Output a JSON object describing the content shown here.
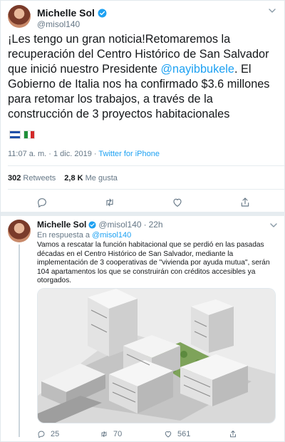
{
  "main_tweet": {
    "author_name": "Michelle Sol",
    "author_handle": "@misol140",
    "text_before_mention": "¡Les tengo un gran noticia!Retomaremos la recuperación del Centro Histórico de San Salvador que inició nuestro Presidente ",
    "mention": "@nayibbukele",
    "text_after_mention": ". El Gobierno de Italia nos ha confirmado $3.6 millones para retomar los trabajos, a través de la construcción de 3 proyectos habitacionales",
    "timestamp": "11:07 a. m. · 1 dic. 2019 · ",
    "source": "Twitter for iPhone",
    "retweets_count": "302",
    "retweets_label": "Retweets",
    "likes_count": "2,8 K",
    "likes_label": "Me gusta"
  },
  "reply_tweet": {
    "author_name": "Michelle Sol",
    "author_handle": "@misol140",
    "separator": "·",
    "time": "22h",
    "in_reply_prefix": "En respuesta a",
    "in_reply_handle": "@misol140",
    "text": "Vamos a rescatar la función habitacional que se perdió en las pasadas décadas en el Centro Histórico de San Salvador, mediante la implementación de 3 cooperativas de \"vivienda por ayuda mutua\", serán 104 apartamentos los que se construirán con créditos accesibles ya otorgados.",
    "replies_count": "25",
    "retweets_count": "70",
    "likes_count": "561"
  },
  "colors": {
    "accent": "#1da1f2",
    "muted": "#657786",
    "text": "#14171a",
    "divider": "#e6ecf0"
  },
  "icons": [
    "verified-badge-icon",
    "chevron-down-icon",
    "reply-icon",
    "retweet-icon",
    "like-icon",
    "share-icon",
    "flag-el-salvador-icon",
    "flag-italy-icon"
  ]
}
